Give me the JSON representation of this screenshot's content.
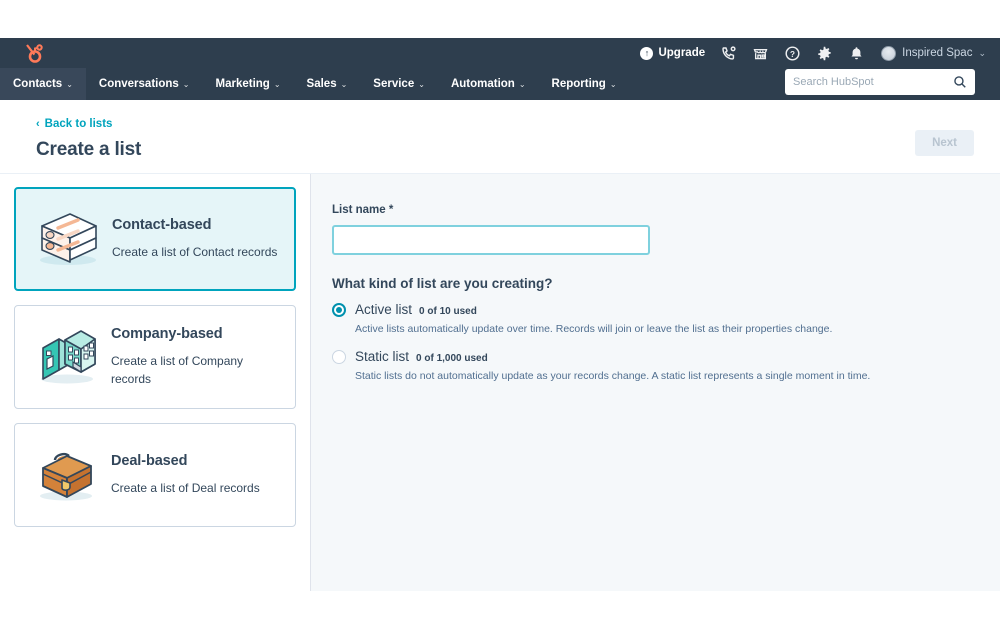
{
  "globalnav": {
    "logo_name": "hubspot-logo",
    "upgrade_label": "Upgrade",
    "icons": [
      {
        "name": "call-icon"
      },
      {
        "name": "marketplace-icon"
      },
      {
        "name": "help-icon"
      },
      {
        "name": "settings-gear-icon"
      },
      {
        "name": "notifications-bell-icon"
      }
    ],
    "account_name": "Inspired Spac",
    "account_caret": "⌄",
    "tabs": [
      {
        "label": "Contacts",
        "caret": "⌄",
        "active": true
      },
      {
        "label": "Conversations",
        "caret": "⌄",
        "active": false
      },
      {
        "label": "Marketing",
        "caret": "⌄",
        "active": false
      },
      {
        "label": "Sales",
        "caret": "⌄",
        "active": false
      },
      {
        "label": "Service",
        "caret": "⌄",
        "active": false
      },
      {
        "label": "Automation",
        "caret": "⌄",
        "active": false
      },
      {
        "label": "Reporting",
        "caret": "⌄",
        "active": false
      }
    ],
    "search": {
      "placeholder": "Search HubSpot",
      "value": "",
      "icon": "search-icon"
    }
  },
  "pageheader": {
    "back_arrow": "‹",
    "back_label": "Back to lists",
    "title": "Create a list",
    "next_label": "Next"
  },
  "options": [
    {
      "illustration": "contact-records-illustration",
      "title": "Contact-based",
      "description": "Create a list of Contact records",
      "selected": true
    },
    {
      "illustration": "company-buildings-illustration",
      "title": "Company-based",
      "description": "Create a list of Company records",
      "selected": false
    },
    {
      "illustration": "deal-briefcase-illustration",
      "title": "Deal-based",
      "description": "Create a list of Deal records",
      "selected": false
    }
  ],
  "form": {
    "name_label": "List name *",
    "name_value": "",
    "name_placeholder": "",
    "question": "What kind of list are you creating?",
    "choices": [
      {
        "label": "Active list",
        "used": "0 of 10 used",
        "description": "Active lists automatically update over time. Records will join or leave the list as their properties change.",
        "selected": true
      },
      {
        "label": "Static list",
        "used": "0 of 1,000 used",
        "description": "Static lists do not automatically update as your records change. A static list represents a single moment in time.",
        "selected": false
      }
    ]
  },
  "colors": {
    "navy": "#2e3e4e",
    "teal": "#00a4bd",
    "text": "#33475b",
    "panel_bg": "#f5f8fa",
    "selected_card_bg": "#e5f5f8",
    "orange": "#ff7a59"
  }
}
